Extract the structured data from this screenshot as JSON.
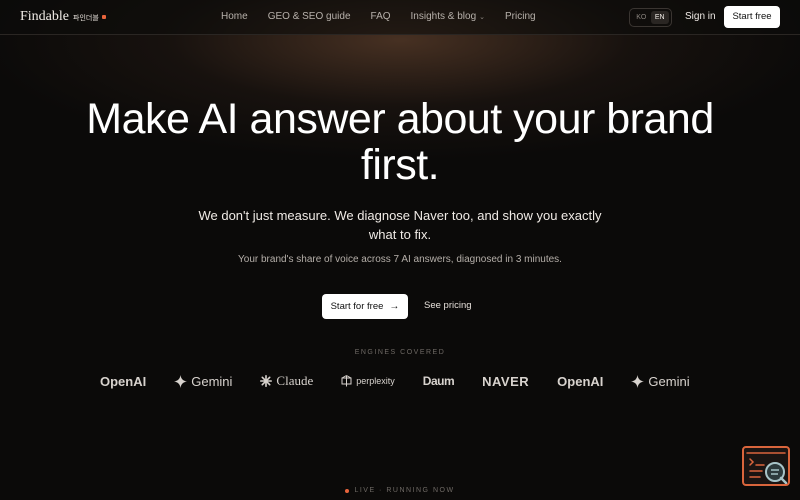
{
  "header": {
    "logo": "Findable",
    "logo_sub": "파인더블",
    "nav": [
      {
        "label": "Home"
      },
      {
        "label": "GEO & SEO guide"
      },
      {
        "label": "FAQ"
      },
      {
        "label": "Insights & blog"
      },
      {
        "label": "Pricing"
      }
    ],
    "lang_options": [
      "KO",
      "EN"
    ],
    "lang_selected": "EN",
    "signin": "Sign in",
    "start_free": "Start free"
  },
  "hero": {
    "title_line1": "Make AI answer about your brand",
    "title_line2": "first.",
    "subtitle": "We don't just measure. We diagnose Naver too, and show you exactly what to fix.",
    "note": "Your brand's share of voice across 7 AI answers, diagnosed in 3 minutes.",
    "cta_primary": "Start for free",
    "cta_secondary": "See pricing"
  },
  "engines": {
    "label": "ENGINES COVERED",
    "items": [
      {
        "name": "OpenAI",
        "icon": "none"
      },
      {
        "name": "Gemini",
        "icon": "gemini-star-icon"
      },
      {
        "name": "Claude",
        "icon": "claude-burst-icon"
      },
      {
        "name": "perplexity",
        "icon": "perplexity-icon"
      },
      {
        "name": "Daum",
        "icon": "daum-wordmark"
      },
      {
        "name": "NAVER",
        "icon": "none"
      },
      {
        "name": "OpenAI",
        "icon": "none"
      },
      {
        "name": "Gemini",
        "icon": "gemini-star-icon"
      }
    ]
  },
  "status": {
    "live_label": "LIVE · RUNNING NOW"
  },
  "colors": {
    "accent": "#e8643c",
    "background": "#0b0a09"
  }
}
